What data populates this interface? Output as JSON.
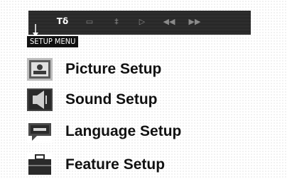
{
  "toolbar": {
    "icons": [
      {
        "name": "setup-icon",
        "glyph": "Tδ"
      },
      {
        "name": "display-icon",
        "glyph": "▭"
      },
      {
        "name": "audio-icon",
        "glyph": "‡"
      },
      {
        "name": "play-icon",
        "glyph": "▷"
      },
      {
        "name": "rewind-icon",
        "glyph": "◀◀"
      },
      {
        "name": "forward-icon",
        "glyph": "▶▶"
      }
    ]
  },
  "menu": {
    "title": "SETUP MENU",
    "items": [
      {
        "label": "Picture Setup",
        "icon": "picture-icon"
      },
      {
        "label": "Sound Setup",
        "icon": "sound-icon"
      },
      {
        "label": "Language Setup",
        "icon": "language-icon"
      },
      {
        "label": "Feature Setup",
        "icon": "feature-icon"
      }
    ]
  }
}
